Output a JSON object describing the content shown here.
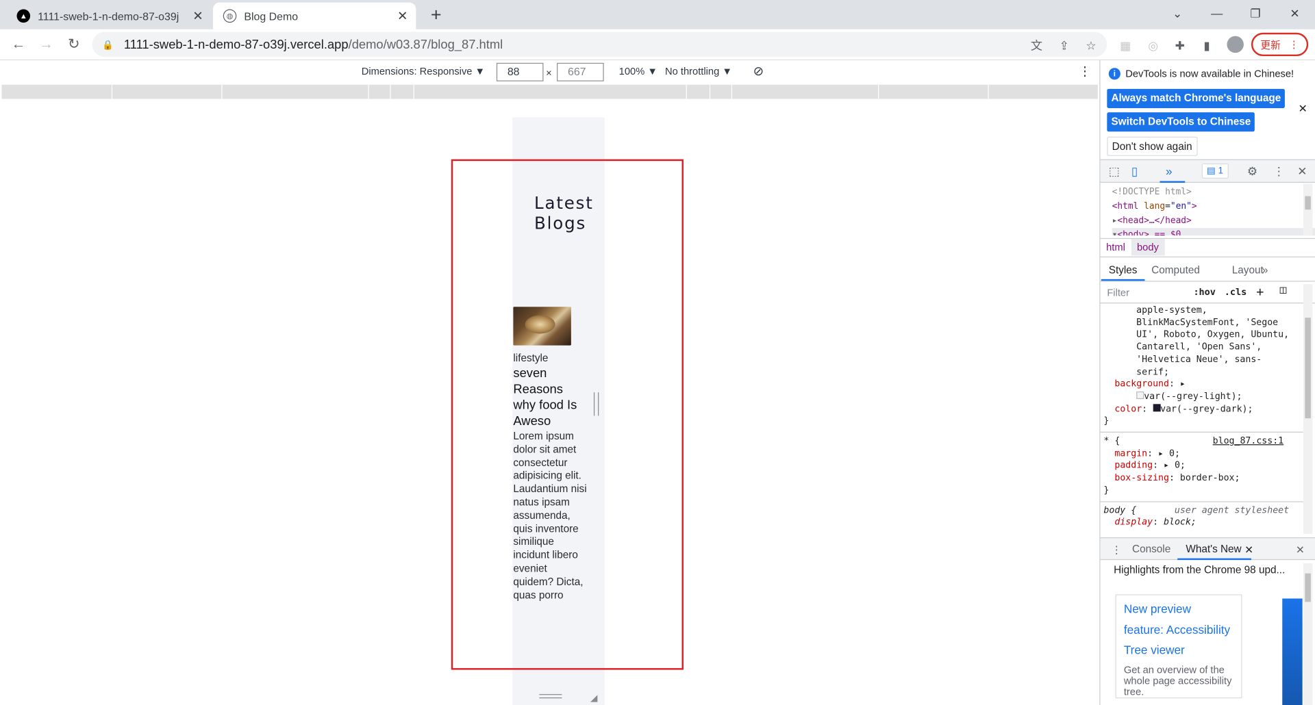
{
  "browser": {
    "tabs": [
      {
        "title": "1111-sweb-1-n-demo-87-o39j",
        "active": false
      },
      {
        "title": "Blog Demo",
        "active": true
      }
    ],
    "url_host": "1111-sweb-1-n-demo-87-o39j.vercel.app",
    "url_path": "/demo/w03.87/blog_87.html",
    "update_label": "更新"
  },
  "device_toolbar": {
    "dimensions_label": "Dimensions: Responsive ▼",
    "width_value": "88",
    "times": "×",
    "height_value": "667",
    "zoom_label": "100% ▼",
    "throttle_label": "No throttling ▼"
  },
  "page": {
    "heading_line1": "Latest",
    "heading_line2": "Blogs",
    "post": {
      "category": "lifestyle",
      "title": "seven Reasons why food Is Aweso",
      "body": "Lorem ipsum dolor sit amet consectetur adipisicing elit. Laudantium nisi natus ipsam assumenda, quis inventore similique incidunt libero eveniet quidem? Dicta, quas porro"
    }
  },
  "devtools": {
    "info_message": "DevTools is now available in Chinese!",
    "btn_match_language": "Always match Chrome's language",
    "btn_switch_chinese": "Switch DevTools to Chinese",
    "btn_dont_show": "Don't show again",
    "issues_count": "1",
    "dom": {
      "doctype": "<!DOCTYPE html>",
      "html_open_tag": "<html",
      "html_attr": "lang",
      "html_attr_val": "\"en\"",
      "head_line": "<head>…</head>",
      "body_line": "<body> == $0"
    },
    "breadcrumbs": [
      "html",
      "body"
    ],
    "subtabs": [
      "Styles",
      "Computed",
      "Layout"
    ],
    "filter_placeholder": "Filter",
    "hov": ":hov",
    "cls": ".cls",
    "css_lines": [
      "      apple-system,",
      "      BlinkMacSystemFont, 'Segoe",
      "      UI', Roboto, Oxygen, Ubuntu,",
      "      Cantarell, 'Open Sans',",
      "      'Helvetica Neue', sans-",
      "      serif;"
    ],
    "css_background_prop": "background",
    "css_background_val": "var(--grey-light);",
    "css_color_prop": "color",
    "css_color_val": "var(--grey-dark);",
    "rule2_selector": "* {",
    "rule2_source": "blog_87.css:1",
    "rule2_props": [
      {
        "p": "margin",
        "v": "0;"
      },
      {
        "p": "padding",
        "v": "0;"
      },
      {
        "p": "box-sizing",
        "v": "border-box;"
      }
    ],
    "rule3_selector": "body {",
    "rule3_source": "user agent stylesheet",
    "rule3_prop": "display",
    "rule3_val": "block;",
    "drawer_tabs": [
      "Console",
      "What's New"
    ],
    "whatsnew_heading": "Highlights from the Chrome 98 upd...",
    "card_title": "New preview feature: Accessibility Tree viewer",
    "card_desc": "Get an overview of the whole page accessibility tree."
  },
  "colors": {
    "highlight": "#e01e26",
    "accent": "#1a73e8",
    "page_bg": "#f3f4f8"
  }
}
